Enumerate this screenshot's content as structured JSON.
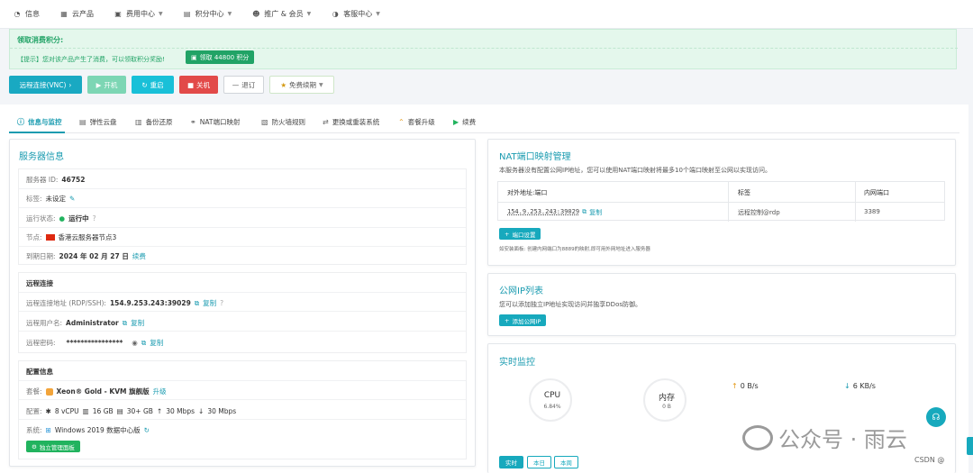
{
  "nav": {
    "items": [
      {
        "label": "信息",
        "icon": "gauge-icon"
      },
      {
        "label": "云产品",
        "icon": "cubes-icon"
      },
      {
        "label": "费用中心",
        "icon": "wallet-icon"
      },
      {
        "label": "积分中心",
        "icon": "gift-icon"
      },
      {
        "label": "推广 & 会员",
        "icon": "users-icon"
      },
      {
        "label": "客服中心",
        "icon": "headset-icon"
      }
    ]
  },
  "notice": {
    "title": "领取消费积分:",
    "text": "【提示】您对该产品产生了消费，可以领取积分奖励!",
    "claim_label": "领取 44800 积分"
  },
  "actions": {
    "vnc": "远程连接(VNC)",
    "start": "开机",
    "restart": "重启",
    "stop": "关机",
    "renew": "退订",
    "free": "免费续期"
  },
  "tabs": [
    {
      "label": "信息与监控",
      "icon": "info-icon"
    },
    {
      "label": "弹性云盘",
      "icon": "disk-icon"
    },
    {
      "label": "备份还原",
      "icon": "server-icon"
    },
    {
      "label": "NAT端口映射",
      "icon": "network-icon"
    },
    {
      "label": "防火墙规则",
      "icon": "firewall-icon"
    },
    {
      "label": "更换或重装系统",
      "icon": "swap-icon"
    },
    {
      "label": "套餐升级",
      "icon": "upgrade-icon"
    },
    {
      "label": "续费",
      "icon": "renew-icon"
    }
  ],
  "server": {
    "title": "服务器信息",
    "id_label": "服务器 ID:",
    "id": "46752",
    "tag_label": "标签:",
    "tag": "未设定",
    "status_label": "运行状态:",
    "status": "运行中",
    "node_label": "节点:",
    "node": "香港云服务器节点3",
    "expire_label": "到期日期:",
    "expire": "2024 年 02 月 27 日",
    "renew_link": "续费"
  },
  "remote": {
    "title": "远程连接",
    "addr_label": "远程连接地址 (RDP/SSH):",
    "addr": "154.9.253.243:39029",
    "user_label": "远程用户名:",
    "user": "Administrator",
    "pass_label": "远程密码:",
    "pass": "****************",
    "copy": "复制"
  },
  "config": {
    "title": "配置信息",
    "plan_label": "套餐:",
    "plan": "Xeon® Gold - KVM 旗舰版",
    "upgrade": "升级",
    "spec_label": "配置:",
    "cpu": "8 vCPU",
    "ram": "16 GB",
    "disk": "30+ GB",
    "up": "30 Mbps",
    "down": "30 Mbps",
    "os_label": "系统:",
    "os": "Windows 2019 数据中心版",
    "panel_btn": "独立管理面板"
  },
  "nat": {
    "title": "NAT端口映射管理",
    "desc": "本服务器没有配置公网IP地址，您可以使用NAT端口映射将最多10个端口映射至公网以实现访问。",
    "headers": [
      "对外地址:端口",
      "标签",
      "内网端口"
    ],
    "rows": [
      {
        "addr": "154.9.253.243:39029",
        "copy": "复制",
        "label": "远程控制@rdp",
        "port": "3389"
      }
    ],
    "setup_btn": "端口设置",
    "hint": "如安装面板: 创建内网端口为8889的映射,即可用外网地址进入服务器"
  },
  "publicip": {
    "title": "公网IP列表",
    "desc": "您可以添加独立IP地址实现访问并独享DDos防御。",
    "add_btn": "添加公网IP"
  },
  "monitor": {
    "title": "实时监控",
    "cpu_label": "CPU",
    "cpu_value": "6.84%",
    "mem_label": "内存",
    "mem_value": "0 B",
    "up": "0 B/s",
    "down": "6 KB/s",
    "tabs": [
      "实时",
      "本日",
      "本周"
    ]
  },
  "watermark": {
    "text": "公众号 · 雨云",
    "csdn": "CSDN @"
  },
  "colors": {
    "accent": "#1a9bb0",
    "success": "#21b35e",
    "danger": "#e24a49"
  }
}
